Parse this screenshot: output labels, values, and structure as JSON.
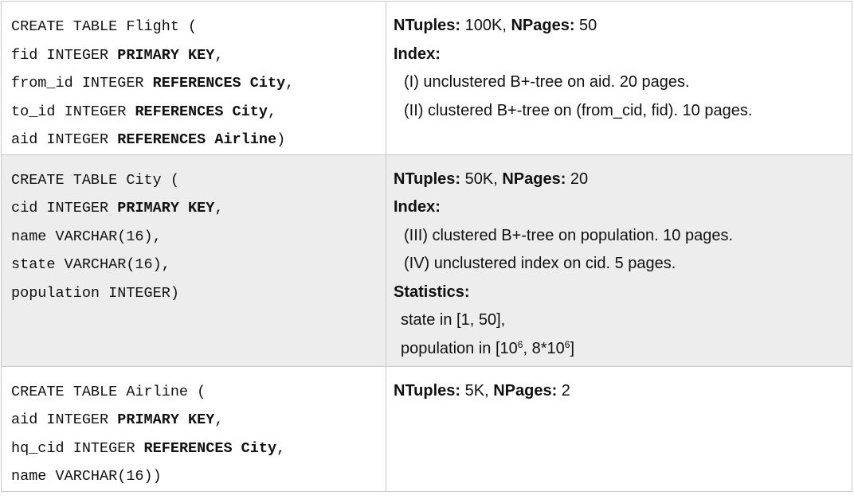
{
  "flight": {
    "ddl": {
      "l1": "CREATE TABLE Flight (",
      "l2a": "fid INTEGER ",
      "l2b": "PRIMARY KEY",
      "l2c": ",",
      "l3a": "from_id INTEGER ",
      "l3b": "REFERENCES City",
      "l3c": ",",
      "l4a": "to_id INTEGER ",
      "l4b": "REFERENCES City",
      "l4c": ",",
      "l5a": "aid INTEGER ",
      "l5b": "REFERENCES Airline",
      "l5c": ")"
    },
    "stats": {
      "ntuples_label": "NTuples:",
      "ntuples_value": " 100K, ",
      "npages_label": "NPages:",
      "npages_value": " 50",
      "index_label": "Index:",
      "index1": "(I) unclustered B+-tree on aid. 20 pages.",
      "index2": "(II) clustered B+-tree on (from_cid, fid). 10 pages."
    }
  },
  "city": {
    "ddl": {
      "l1": "CREATE TABLE City (",
      "l2a": "cid INTEGER ",
      "l2b": "PRIMARY KEY",
      "l2c": ",",
      "l3": "name VARCHAR(16),",
      "l4": "state VARCHAR(16),",
      "l5": "population INTEGER)"
    },
    "stats": {
      "ntuples_label": "NTuples:",
      "ntuples_value": " 50K, ",
      "npages_label": "NPages:",
      "npages_value": " 20",
      "index_label": "Index:",
      "index3": "(III) clustered B+-tree on population. 10 pages.",
      "index4": "(IV) unclustered index on cid. 5 pages.",
      "statistics_label": "Statistics:",
      "stat1": "state in [1, 50],",
      "stat2_prefix": "population in [10",
      "stat2_exp1": "6",
      "stat2_mid": ", 8*10",
      "stat2_exp2": "6",
      "stat2_suffix": "]"
    }
  },
  "airline": {
    "ddl": {
      "l1": "CREATE TABLE Airline (",
      "l2a": "aid INTEGER ",
      "l2b": "PRIMARY KEY",
      "l2c": ",",
      "l3a": "hq_cid INTEGER ",
      "l3b": "REFERENCES City",
      "l3c": ",",
      "l4": "name VARCHAR(16))"
    },
    "stats": {
      "ntuples_label": "NTuples:",
      "ntuples_value": " 5K, ",
      "npages_label": "NPages:",
      "npages_value": " 2"
    }
  }
}
